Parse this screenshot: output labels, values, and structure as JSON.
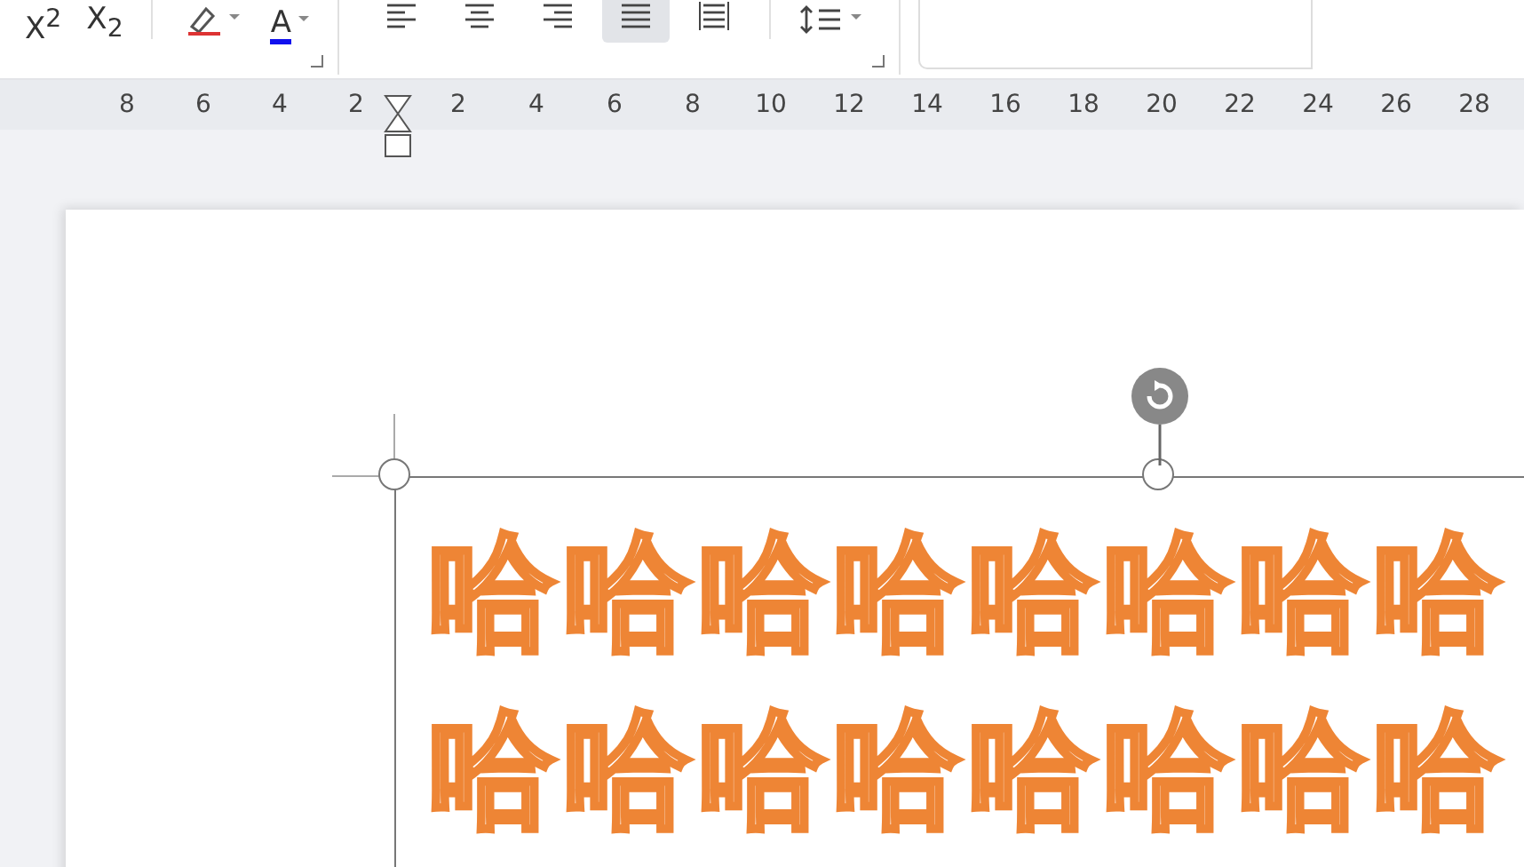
{
  "toolbar": {
    "script_buttons": [
      {
        "label": "X$^{2}$"
      },
      {
        "label": "X$_{2}$"
      }
    ],
    "color_buttons": [
      {
        "kind": "highlight"
      },
      {
        "kind": "font-color",
        "label": "A"
      }
    ],
    "align_buttons": [
      {
        "kind": "left",
        "selected": false
      },
      {
        "kind": "center",
        "selected": false
      },
      {
        "kind": "right",
        "selected": false
      },
      {
        "kind": "justify",
        "selected": true
      },
      {
        "kind": "distributed",
        "selected": false
      }
    ]
  },
  "ruler": {
    "left_numbers": [
      "8",
      "6",
      "4",
      "2"
    ],
    "right_numbers": [
      "2",
      "4",
      "6",
      "8",
      "10",
      "12",
      "14",
      "16",
      "18",
      "20",
      "22",
      "24",
      "26",
      "28"
    ]
  },
  "textbox": {
    "lines": [
      "哈哈哈哈哈哈哈哈",
      "哈哈哈哈哈哈哈哈"
    ]
  }
}
